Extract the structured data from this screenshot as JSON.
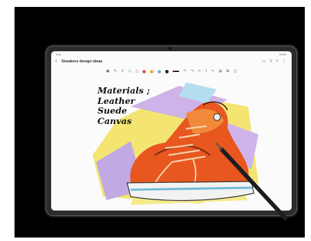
{
  "status": {
    "time": "9:41",
    "battery": "100%"
  },
  "header": {
    "title": "Sneakers design ideas"
  },
  "toolbar": {
    "left_icons": [
      "text-icon",
      "pen-icon",
      "highlighter-icon",
      "eraser-icon",
      "shape-icon"
    ],
    "colors": [
      "#e8563c",
      "#f0a430",
      "#6fb8d8",
      "#222222"
    ],
    "right_icons": [
      "undo-icon",
      "redo-icon",
      "lasso-icon",
      "ruler-icon",
      "cursor-icon",
      "image-icon",
      "copy-icon",
      "layers-icon"
    ]
  },
  "top_actions": [
    "book-icon",
    "share-icon",
    "attach-icon",
    "more-icon"
  ],
  "canvas": {
    "note_lines": [
      "Materials ;",
      "Leather",
      "Suede",
      "Canvas"
    ],
    "drawing": "sneaker-illustration"
  }
}
